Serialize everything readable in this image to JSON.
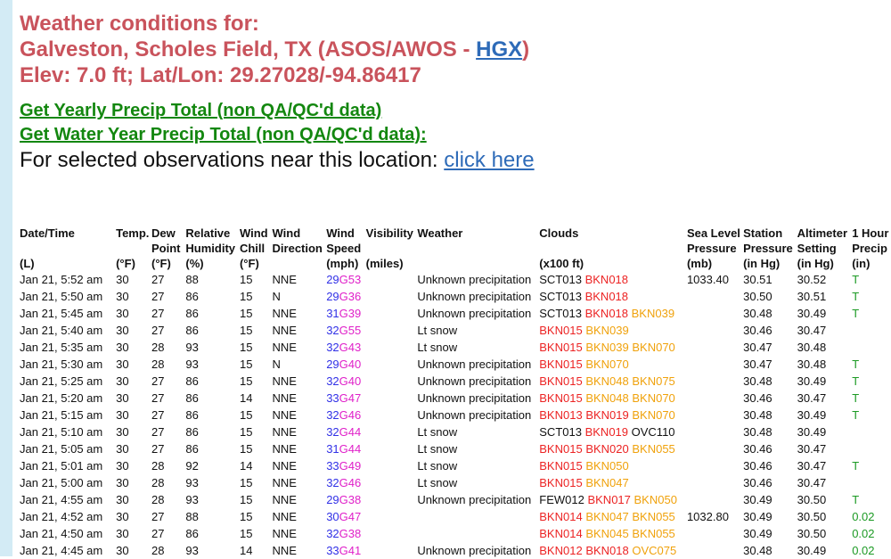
{
  "header": {
    "line1": "Weather conditions for:",
    "line2_prefix": "Galveston, Scholes Field, TX (ASOS/AWOS - ",
    "line2_link": "HGX",
    "line2_suffix": ")",
    "line3": "Elev: 7.0 ft; Lat/Lon: 29.27028/-94.86417"
  },
  "links": {
    "yearly": "Get Yearly Precip Total (non QA/QC'd data)",
    "water_year": "Get Water Year Precip Total (non QA/QC'd data):",
    "observations_prefix": "For selected observations near this location: ",
    "click_here": "click here"
  },
  "table": {
    "headers": [
      {
        "l1": "Date/Time",
        "l2": "",
        "l3": "(L)"
      },
      {
        "l1": "Temp.",
        "l2": "",
        "l3": "(°F)"
      },
      {
        "l1": "Dew",
        "l2": "Point",
        "l3": "(°F)"
      },
      {
        "l1": "Relative",
        "l2": "Humidity",
        "l3": "(%)"
      },
      {
        "l1": "Wind",
        "l2": "Chill",
        "l3": "(°F)"
      },
      {
        "l1": "Wind",
        "l2": "Direction",
        "l3": ""
      },
      {
        "l1": "Wind",
        "l2": "Speed",
        "l3": "(mph)"
      },
      {
        "l1": "Visibility",
        "l2": "",
        "l3": "(miles)"
      },
      {
        "l1": "Weather",
        "l2": "",
        "l3": ""
      },
      {
        "l1": "Clouds",
        "l2": "",
        "l3": "(x100 ft)"
      },
      {
        "l1": "Sea Level",
        "l2": "Pressure",
        "l3": "(mb)"
      },
      {
        "l1": "Station",
        "l2": "Pressure",
        "l3": "(in Hg)"
      },
      {
        "l1": "Altimeter",
        "l2": "Setting",
        "l3": "(in Hg)"
      },
      {
        "l1": "1 Hour",
        "l2": "Precip",
        "l3": "(in)"
      }
    ],
    "rows": [
      {
        "dt": "Jan 21, 5:52 am",
        "t": "30",
        "dp": "27",
        "rh": "88",
        "wc": "15",
        "wd": "NNE",
        "spd": "29",
        "gst": "G53",
        "vis": "",
        "wx": "Unknown precipitation",
        "clouds": [
          {
            "text": "SCT013",
            "cls": "sct"
          },
          {
            "text": "BKN018",
            "cls": "bkn"
          }
        ],
        "slp": "1033.40",
        "stp": "30.51",
        "alt": "30.52",
        "pr": "T"
      },
      {
        "dt": "Jan 21, 5:50 am",
        "t": "30",
        "dp": "27",
        "rh": "86",
        "wc": "15",
        "wd": "N",
        "spd": "29",
        "gst": "G36",
        "vis": "",
        "wx": "Unknown precipitation",
        "clouds": [
          {
            "text": "SCT013",
            "cls": "sct"
          },
          {
            "text": "BKN018",
            "cls": "bkn"
          }
        ],
        "slp": "",
        "stp": "30.50",
        "alt": "30.51",
        "pr": "T"
      },
      {
        "dt": "Jan 21, 5:45 am",
        "t": "30",
        "dp": "27",
        "rh": "86",
        "wc": "15",
        "wd": "NNE",
        "spd": "31",
        "gst": "G39",
        "vis": "",
        "wx": "Unknown precipitation",
        "clouds": [
          {
            "text": "SCT013",
            "cls": "sct"
          },
          {
            "text": "BKN018",
            "cls": "bkn"
          },
          {
            "text": "BKN039",
            "cls": "bknh"
          }
        ],
        "slp": "",
        "stp": "30.48",
        "alt": "30.49",
        "pr": "T"
      },
      {
        "dt": "Jan 21, 5:40 am",
        "t": "30",
        "dp": "27",
        "rh": "86",
        "wc": "15",
        "wd": "NNE",
        "spd": "32",
        "gst": "G55",
        "vis": "",
        "wx": "Lt snow",
        "clouds": [
          {
            "text": "BKN015",
            "cls": "bkn"
          },
          {
            "text": "BKN039",
            "cls": "bknh"
          }
        ],
        "slp": "",
        "stp": "30.46",
        "alt": "30.47",
        "pr": ""
      },
      {
        "dt": "Jan 21, 5:35 am",
        "t": "30",
        "dp": "28",
        "rh": "93",
        "wc": "15",
        "wd": "NNE",
        "spd": "32",
        "gst": "G43",
        "vis": "",
        "wx": "Lt snow",
        "clouds": [
          {
            "text": "BKN015",
            "cls": "bkn"
          },
          {
            "text": "BKN039",
            "cls": "bknh"
          },
          {
            "text": "BKN070",
            "cls": "bknh"
          }
        ],
        "slp": "",
        "stp": "30.47",
        "alt": "30.48",
        "pr": ""
      },
      {
        "dt": "Jan 21, 5:30 am",
        "t": "30",
        "dp": "28",
        "rh": "93",
        "wc": "15",
        "wd": "N",
        "spd": "29",
        "gst": "G40",
        "vis": "",
        "wx": "Unknown precipitation",
        "clouds": [
          {
            "text": "BKN015",
            "cls": "bkn"
          },
          {
            "text": "BKN070",
            "cls": "bknh"
          }
        ],
        "slp": "",
        "stp": "30.47",
        "alt": "30.48",
        "pr": "T"
      },
      {
        "dt": "Jan 21, 5:25 am",
        "t": "30",
        "dp": "27",
        "rh": "86",
        "wc": "15",
        "wd": "NNE",
        "spd": "32",
        "gst": "G40",
        "vis": "",
        "wx": "Unknown precipitation",
        "clouds": [
          {
            "text": "BKN015",
            "cls": "bkn"
          },
          {
            "text": "BKN048",
            "cls": "bknh"
          },
          {
            "text": "BKN075",
            "cls": "bknh"
          }
        ],
        "slp": "",
        "stp": "30.48",
        "alt": "30.49",
        "pr": "T"
      },
      {
        "dt": "Jan 21, 5:20 am",
        "t": "30",
        "dp": "27",
        "rh": "86",
        "wc": "14",
        "wd": "NNE",
        "spd": "33",
        "gst": "G47",
        "vis": "",
        "wx": "Unknown precipitation",
        "clouds": [
          {
            "text": "BKN015",
            "cls": "bkn"
          },
          {
            "text": "BKN048",
            "cls": "bknh"
          },
          {
            "text": "BKN070",
            "cls": "bknh"
          }
        ],
        "slp": "",
        "stp": "30.46",
        "alt": "30.47",
        "pr": "T"
      },
      {
        "dt": "Jan 21, 5:15 am",
        "t": "30",
        "dp": "27",
        "rh": "86",
        "wc": "15",
        "wd": "NNE",
        "spd": "32",
        "gst": "G46",
        "vis": "",
        "wx": "Unknown precipitation",
        "clouds": [
          {
            "text": "BKN013",
            "cls": "bkn"
          },
          {
            "text": "BKN019",
            "cls": "bkn"
          },
          {
            "text": "BKN070",
            "cls": "bknh"
          }
        ],
        "slp": "",
        "stp": "30.48",
        "alt": "30.49",
        "pr": "T"
      },
      {
        "dt": "Jan 21, 5:10 am",
        "t": "30",
        "dp": "27",
        "rh": "86",
        "wc": "15",
        "wd": "NNE",
        "spd": "32",
        "gst": "G44",
        "vis": "",
        "wx": "Lt snow",
        "clouds": [
          {
            "text": "SCT013",
            "cls": "sct"
          },
          {
            "text": "BKN019",
            "cls": "bkn"
          },
          {
            "text": "OVC110",
            "cls": "ovc"
          }
        ],
        "slp": "",
        "stp": "30.48",
        "alt": "30.49",
        "pr": ""
      },
      {
        "dt": "Jan 21, 5:05 am",
        "t": "30",
        "dp": "27",
        "rh": "86",
        "wc": "15",
        "wd": "NNE",
        "spd": "31",
        "gst": "G44",
        "vis": "",
        "wx": "Lt snow",
        "clouds": [
          {
            "text": "BKN015",
            "cls": "bkn"
          },
          {
            "text": "BKN020",
            "cls": "bkn"
          },
          {
            "text": "BKN055",
            "cls": "bknh"
          }
        ],
        "slp": "",
        "stp": "30.46",
        "alt": "30.47",
        "pr": ""
      },
      {
        "dt": "Jan 21, 5:01 am",
        "t": "30",
        "dp": "28",
        "rh": "92",
        "wc": "14",
        "wd": "NNE",
        "spd": "33",
        "gst": "G49",
        "vis": "",
        "wx": "Lt snow",
        "clouds": [
          {
            "text": "BKN015",
            "cls": "bkn"
          },
          {
            "text": "BKN050",
            "cls": "bknh"
          }
        ],
        "slp": "",
        "stp": "30.46",
        "alt": "30.47",
        "pr": "T"
      },
      {
        "dt": "Jan 21, 5:00 am",
        "t": "30",
        "dp": "28",
        "rh": "93",
        "wc": "15",
        "wd": "NNE",
        "spd": "32",
        "gst": "G46",
        "vis": "",
        "wx": "Lt snow",
        "clouds": [
          {
            "text": "BKN015",
            "cls": "bkn"
          },
          {
            "text": "BKN047",
            "cls": "bknh"
          }
        ],
        "slp": "",
        "stp": "30.46",
        "alt": "30.47",
        "pr": ""
      },
      {
        "dt": "Jan 21, 4:55 am",
        "t": "30",
        "dp": "28",
        "rh": "93",
        "wc": "15",
        "wd": "NNE",
        "spd": "29",
        "gst": "G38",
        "vis": "",
        "wx": "Unknown precipitation",
        "clouds": [
          {
            "text": "FEW012",
            "cls": "few"
          },
          {
            "text": "BKN017",
            "cls": "bkn"
          },
          {
            "text": "BKN050",
            "cls": "bknh"
          }
        ],
        "slp": "",
        "stp": "30.49",
        "alt": "30.50",
        "pr": "T"
      },
      {
        "dt": "Jan 21, 4:52 am",
        "t": "30",
        "dp": "27",
        "rh": "88",
        "wc": "15",
        "wd": "NNE",
        "spd": "30",
        "gst": "G47",
        "vis": "",
        "wx": "",
        "clouds": [
          {
            "text": "BKN014",
            "cls": "bkn"
          },
          {
            "text": "BKN047",
            "cls": "bknh"
          },
          {
            "text": "BKN055",
            "cls": "bknh"
          }
        ],
        "slp": "1032.80",
        "stp": "30.49",
        "alt": "30.50",
        "pr": "0.02"
      },
      {
        "dt": "Jan 21, 4:50 am",
        "t": "30",
        "dp": "27",
        "rh": "86",
        "wc": "15",
        "wd": "NNE",
        "spd": "32",
        "gst": "G38",
        "vis": "",
        "wx": "",
        "clouds": [
          {
            "text": "BKN014",
            "cls": "bkn"
          },
          {
            "text": "BKN045",
            "cls": "bknh"
          },
          {
            "text": "BKN055",
            "cls": "bknh"
          }
        ],
        "slp": "",
        "stp": "30.49",
        "alt": "30.50",
        "pr": "0.02"
      },
      {
        "dt": "Jan 21, 4:45 am",
        "t": "30",
        "dp": "28",
        "rh": "93",
        "wc": "14",
        "wd": "NNE",
        "spd": "33",
        "gst": "G41",
        "vis": "",
        "wx": "Unknown precipitation",
        "clouds": [
          {
            "text": "BKN012",
            "cls": "bkn"
          },
          {
            "text": "BKN018",
            "cls": "bkn"
          },
          {
            "text": "OVC075",
            "cls": "ovch"
          }
        ],
        "slp": "",
        "stp": "30.48",
        "alt": "30.49",
        "pr": "0.02"
      }
    ]
  }
}
